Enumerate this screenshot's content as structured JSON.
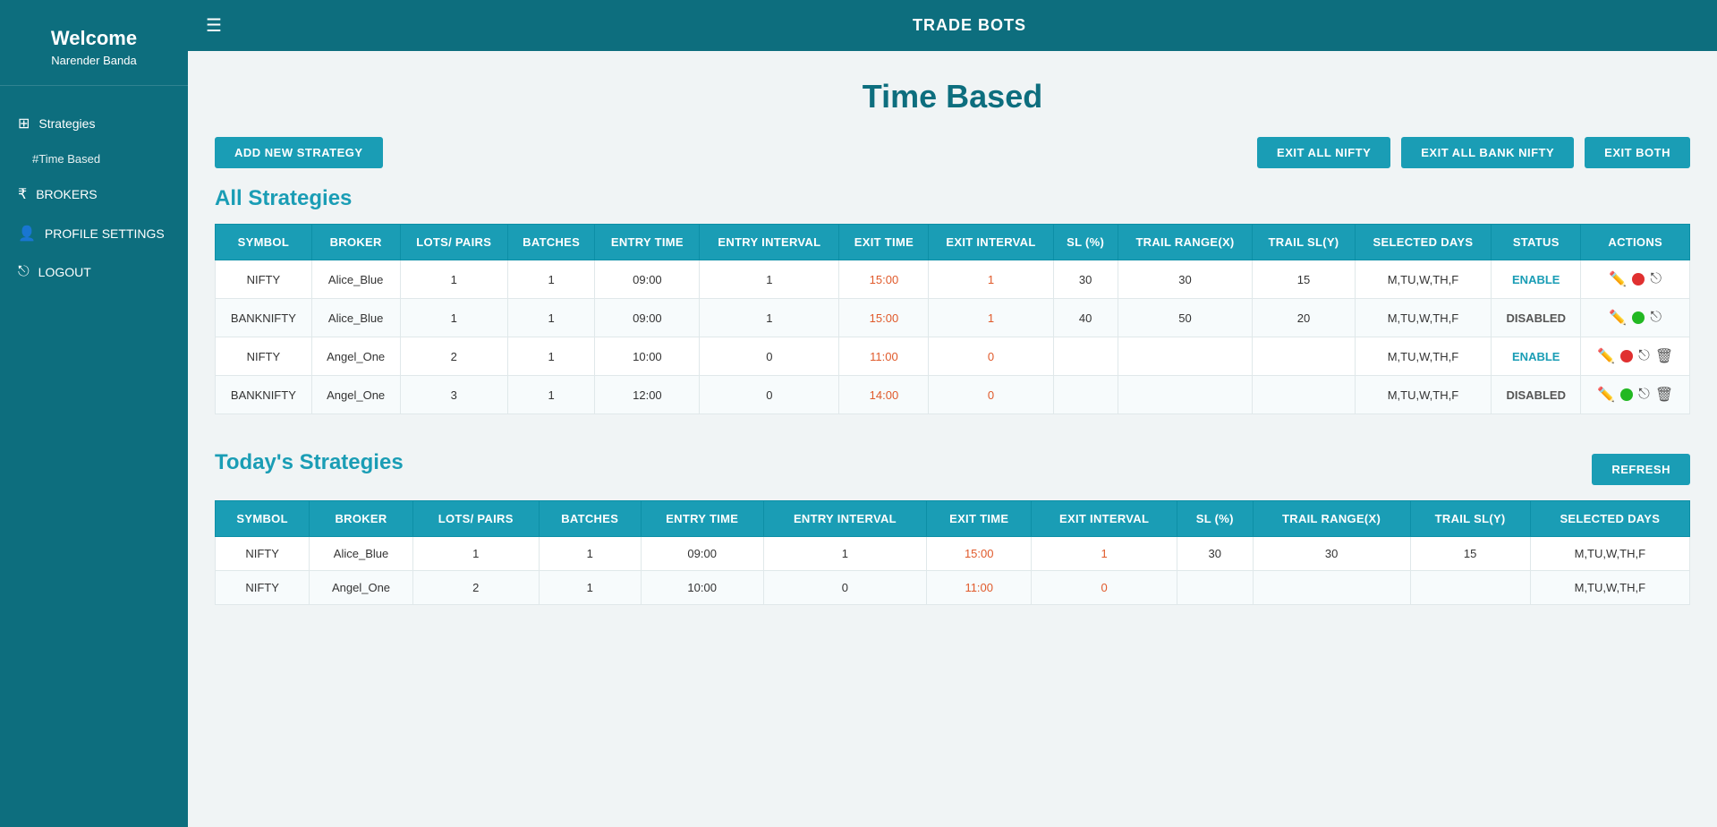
{
  "sidebar": {
    "welcome": "Welcome",
    "username": "Narender Banda",
    "nav": [
      {
        "id": "strategies",
        "label": "Strategies",
        "icon": "⊞",
        "type": "section"
      },
      {
        "id": "time-based",
        "label": "Time Based",
        "icon": "⏱",
        "type": "sub"
      },
      {
        "id": "brokers",
        "label": "BROKERS",
        "icon": "₹",
        "type": "item"
      },
      {
        "id": "profile-settings",
        "label": "PROFILE SETTINGS",
        "icon": "👤",
        "type": "item"
      },
      {
        "id": "logout",
        "label": "LOGOUT",
        "icon": "⎋",
        "type": "item"
      }
    ]
  },
  "topbar": {
    "title": "TRADE BOTS"
  },
  "page": {
    "heading": "Time Based",
    "buttons": {
      "add": "ADD NEW STRATEGY",
      "exit_nifty": "EXIT ALL NIFTY",
      "exit_bank_nifty": "EXIT ALL BANK NIFTY",
      "exit_both": "EXIT BOTH"
    }
  },
  "all_strategies": {
    "title": "All Strategies",
    "columns": [
      "SYMBOL",
      "BROKER",
      "LOTS/ PAIRS",
      "BATCHES",
      "ENTRY TIME",
      "ENTRY INTERVAL",
      "EXIT TIME",
      "EXIT INTERVAL",
      "SL (%)",
      "TRAIL RANGE(X)",
      "TRAIL SL(Y)",
      "SELECTED DAYS",
      "STATUS",
      "ACTIONS"
    ],
    "rows": [
      {
        "symbol": "NIFTY",
        "broker": "Alice_Blue",
        "lots": "1",
        "batches": "1",
        "entry_time": "09:00",
        "entry_interval": "1",
        "exit_time": "15:00",
        "exit_interval": "1",
        "sl": "30",
        "trail_range": "30",
        "trail_sl": "15",
        "selected_days": "M,TU,W,TH,F",
        "status": "ENABLE",
        "status_type": "enable",
        "dot": "red",
        "has_delete": false
      },
      {
        "symbol": "BANKNIFTY",
        "broker": "Alice_Blue",
        "lots": "1",
        "batches": "1",
        "entry_time": "09:00",
        "entry_interval": "1",
        "exit_time": "15:00",
        "exit_interval": "1",
        "sl": "40",
        "trail_range": "50",
        "trail_sl": "20",
        "selected_days": "M,TU,W,TH,F",
        "status": "DISABLED",
        "status_type": "disabled",
        "dot": "green",
        "has_delete": false
      },
      {
        "symbol": "NIFTY",
        "broker": "Angel_One",
        "lots": "2",
        "batches": "1",
        "entry_time": "10:00",
        "entry_interval": "0",
        "exit_time": "11:00",
        "exit_interval": "0",
        "sl": "",
        "trail_range": "",
        "trail_sl": "",
        "selected_days": "M,TU,W,TH,F",
        "status": "ENABLE",
        "status_type": "enable",
        "dot": "red",
        "has_delete": true
      },
      {
        "symbol": "BANKNIFTY",
        "broker": "Angel_One",
        "lots": "3",
        "batches": "1",
        "entry_time": "12:00",
        "entry_interval": "0",
        "exit_time": "14:00",
        "exit_interval": "0",
        "sl": "",
        "trail_range": "",
        "trail_sl": "",
        "selected_days": "M,TU,W,TH,F",
        "status": "DISABLED",
        "status_type": "disabled",
        "dot": "green",
        "has_delete": true
      }
    ]
  },
  "todays_strategies": {
    "title": "Today's Strategies",
    "refresh_label": "REFRESH",
    "columns": [
      "SYMBOL",
      "BROKER",
      "LOTS/ PAIRS",
      "BATCHES",
      "ENTRY TIME",
      "ENTRY INTERVAL",
      "EXIT TIME",
      "EXIT INTERVAL",
      "SL (%)",
      "TRAIL RANGE(X)",
      "TRAIL SL(Y)",
      "SELECTED DAYS"
    ],
    "rows": [
      {
        "symbol": "NIFTY",
        "broker": "Alice_Blue",
        "lots": "1",
        "batches": "1",
        "entry_time": "09:00",
        "entry_interval": "1",
        "exit_time": "15:00",
        "exit_interval": "1",
        "sl": "30",
        "trail_range": "30",
        "trail_sl": "15",
        "selected_days": "M,TU,W,TH,F"
      },
      {
        "symbol": "NIFTY",
        "broker": "Angel_One",
        "lots": "2",
        "batches": "1",
        "entry_time": "10:00",
        "entry_interval": "0",
        "exit_time": "11:00",
        "exit_interval": "0",
        "sl": "",
        "trail_range": "",
        "trail_sl": "",
        "selected_days": "M,TU,W,TH,F"
      }
    ]
  }
}
